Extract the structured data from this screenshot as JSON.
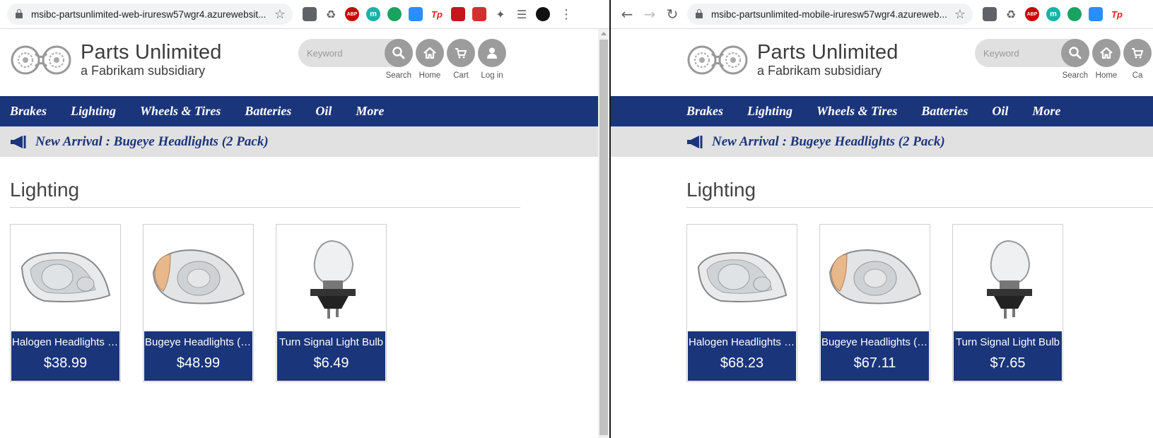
{
  "left": {
    "url": "msibc-partsunlimited-web-iruresw57wgr4.azurewebsit...",
    "site": {
      "brand": "Parts Unlimited",
      "subsidiary": "a Fabrikam subsidiary",
      "search_placeholder": "Keyword",
      "tools": {
        "search": "Search",
        "home": "Home",
        "cart": "Cart",
        "login": "Log in"
      },
      "nav": [
        "Brakes",
        "Lighting",
        "Wheels & Tires",
        "Batteries",
        "Oil",
        "More"
      ],
      "announcement": "New Arrival : Bugeye Headlights (2 Pack)",
      "section": "Lighting",
      "products": [
        {
          "name": "Halogen Headlights (...",
          "price": "$38.99"
        },
        {
          "name": "Bugeye Headlights (2...",
          "price": "$48.99"
        },
        {
          "name": "Turn Signal Light Bulb",
          "price": "$6.49"
        }
      ]
    }
  },
  "right": {
    "url": "msibc-partsunlimited-mobile-iruresw57wgr4.azureweb...",
    "site": {
      "brand": "Parts Unlimited",
      "subsidiary": "a Fabrikam subsidiary",
      "search_placeholder": "Keyword",
      "tools": {
        "search": "Search",
        "home": "Home",
        "cart": "Ca"
      },
      "nav": [
        "Brakes",
        "Lighting",
        "Wheels & Tires",
        "Batteries",
        "Oil",
        "More"
      ],
      "announcement": "New Arrival : Bugeye Headlights (2 Pack)",
      "section": "Lighting",
      "products": [
        {
          "name": "Halogen Headlights (...",
          "price": "$68.23"
        },
        {
          "name": "Bugeye Headlights (2...",
          "price": "$67.11"
        },
        {
          "name": "Turn Signal Light Bulb",
          "price": "$7.65"
        }
      ]
    }
  },
  "extensions": {
    "abp": "ABP",
    "m": "m",
    "tp": "Tp"
  },
  "colors": {
    "navy": "#1b357b",
    "announce_bg": "#e1e1e1",
    "tool_circle": "#9c9c9c"
  }
}
